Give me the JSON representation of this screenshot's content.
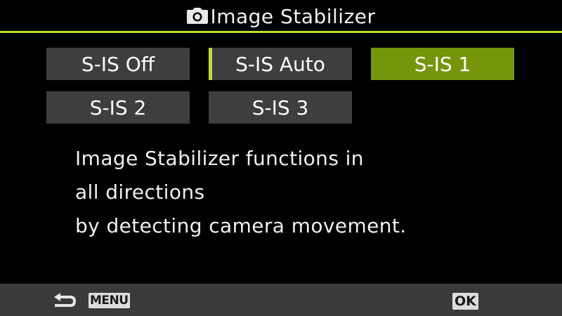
{
  "header": {
    "title": "Image Stabilizer",
    "icon": "camera-icon"
  },
  "options": [
    {
      "label": "S-IS Off",
      "selected": false
    },
    {
      "label": "S-IS Auto",
      "selected": false,
      "cursor": true
    },
    {
      "label": "S-IS 1",
      "selected": true
    },
    {
      "label": "S-IS 2",
      "selected": false
    },
    {
      "label": "S-IS 3",
      "selected": false
    }
  ],
  "description": {
    "lines": [
      "Image Stabilizer functions in",
      "all directions",
      "by detecting camera movement."
    ]
  },
  "footer": {
    "back_icon": "return-arrow-icon",
    "menu_label": "MENU",
    "ok_label": "OK"
  },
  "colors": {
    "accent": "#c5d928",
    "selected": "#73960b",
    "option_bg": "#3e3e3e",
    "footer_bg": "#3a3a3a"
  }
}
